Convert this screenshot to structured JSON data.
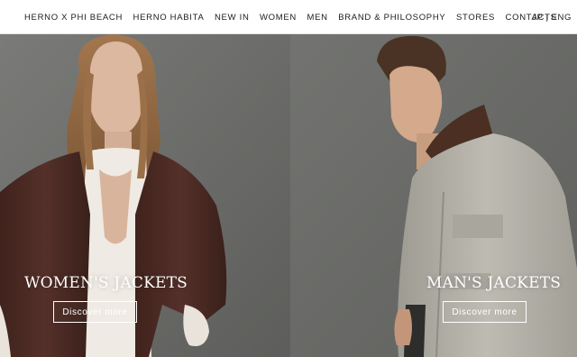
{
  "nav": {
    "items": [
      {
        "label": "HERNO X PHI BEACH"
      },
      {
        "label": "HERNO HABITA"
      },
      {
        "label": "NEW IN"
      },
      {
        "label": "WOMEN"
      },
      {
        "label": "MEN"
      },
      {
        "label": "BRAND & PHILOSOPHY"
      },
      {
        "label": "STORES"
      },
      {
        "label": "CONTACTS"
      }
    ],
    "languages": {
      "jp": "JP",
      "separator": "|",
      "eng": "ENG"
    }
  },
  "hero": {
    "women": {
      "title": "WOMEN'S JACKETS",
      "button_label": "Discover more"
    },
    "men": {
      "title": "MAN'S JACKETS",
      "button_label": "Discover more"
    }
  },
  "colors": {
    "nav_background": "#ffffff",
    "nav_text": "#1b1b1b",
    "hero_background": "#6e6f6c",
    "women_coat": "#4b2b23",
    "men_jacket": "#b6b4ab",
    "overlay_text": "#ffffff"
  }
}
